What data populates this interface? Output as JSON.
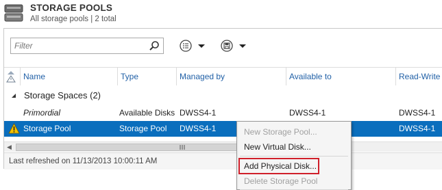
{
  "header": {
    "title": "STORAGE POOLS",
    "subtitle": "All storage pools | 2 total"
  },
  "toolbar": {
    "filter_placeholder": "Filter",
    "buttons": [
      {
        "icon": "view-options-icon"
      },
      {
        "icon": "save-query-icon"
      }
    ]
  },
  "table": {
    "columns": [
      {
        "label": "Name"
      },
      {
        "label": "Type"
      },
      {
        "label": "Managed by"
      },
      {
        "label": "Available to"
      },
      {
        "label": "Read-Write"
      }
    ],
    "group": {
      "label": "Storage Spaces (2)"
    },
    "rows": [
      {
        "name": "Primordial",
        "type": "Available Disks",
        "managed_by": "DWSS4-1",
        "available_to": "DWSS4-1",
        "read_write": "DWSS4-1",
        "selected": false,
        "warning": false
      },
      {
        "name": "Storage Pool",
        "type": "Storage Pool",
        "managed_by": "DWSS4-1",
        "available_to": "",
        "read_write": "DWSS4-1",
        "selected": true,
        "warning": true
      }
    ]
  },
  "footer": {
    "status": "Last refreshed on 11/13/2013 10:00:11 AM"
  },
  "context_menu": {
    "items": [
      {
        "label": "New Storage Pool...",
        "enabled": false
      },
      {
        "label": "New Virtual Disk...",
        "enabled": true
      },
      {
        "label": "Add Physical Disk...",
        "enabled": true,
        "highlighted": true
      },
      {
        "label": "Delete Storage Pool",
        "enabled": false
      }
    ]
  },
  "colors": {
    "selection": "#0a6ebd",
    "column_header_text": "#1f5fa6",
    "highlight_border": "#d01f2a",
    "warning_fill": "#f2c200"
  }
}
